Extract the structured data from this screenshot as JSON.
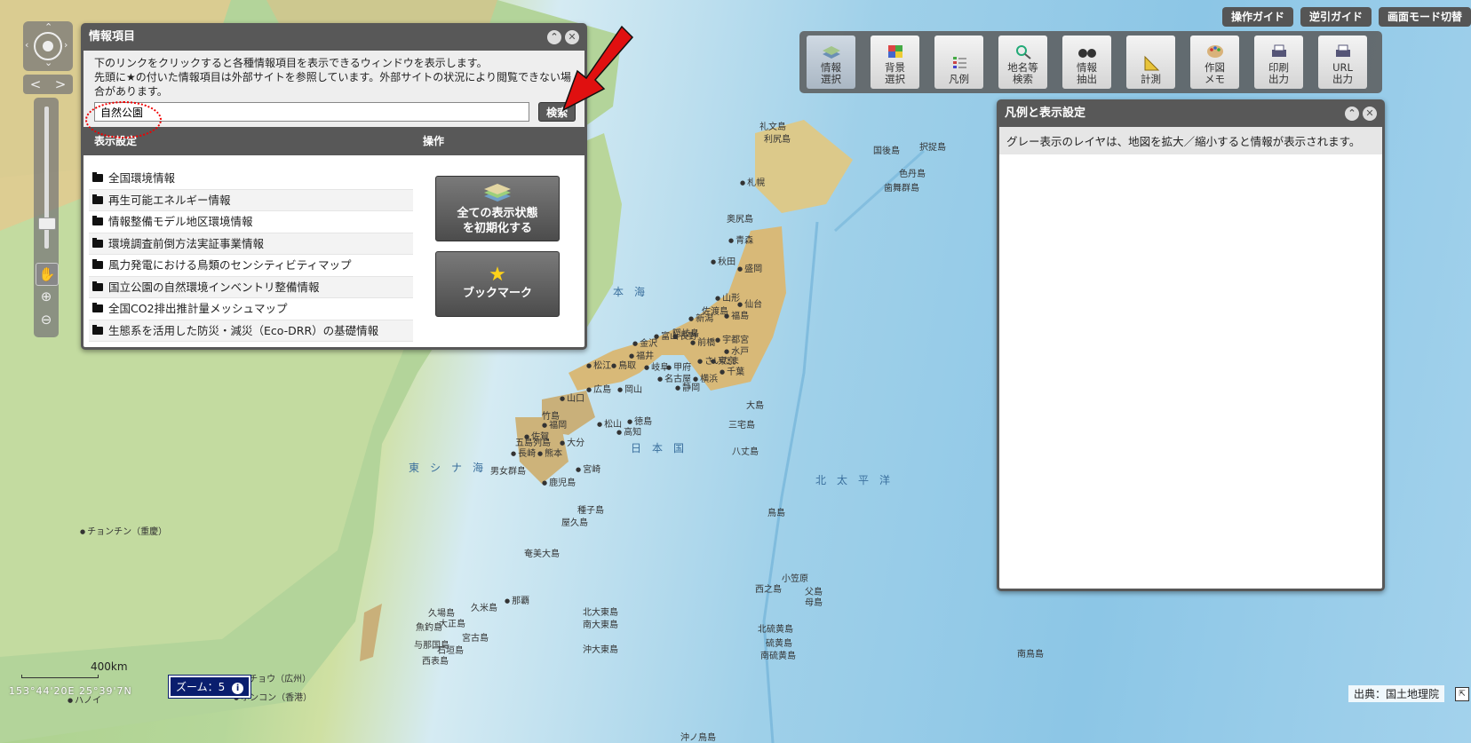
{
  "map": {
    "sea_labels": [
      "本海",
      "東シナ海",
      "日本国",
      "北太平洋"
    ],
    "city_labels": [
      "札幌",
      "青森",
      "秋田",
      "盛岡",
      "山形",
      "仙台",
      "新潟",
      "福島",
      "金沢",
      "富山",
      "長野",
      "前橋",
      "宇都宮",
      "水戸",
      "さいたま",
      "東京",
      "千葉",
      "横浜",
      "甲府",
      "静岡",
      "岐阜",
      "名古屋",
      "福井",
      "松江",
      "鳥取",
      "広島",
      "岡山",
      "山口",
      "松山",
      "高知",
      "徳島",
      "福岡",
      "佐賀",
      "長崎",
      "熊本",
      "大分",
      "宮崎",
      "鹿児島",
      "那覇",
      "チョンチン（重慶）",
      "コワンチョウ（広州）",
      "ホンコン（香港）",
      "ハノイ"
    ],
    "island_labels": [
      "礼文島",
      "利尻島",
      "奥尻島",
      "佐渡島",
      "隠岐島",
      "竹島",
      "屋久島",
      "種子島",
      "奄美大島",
      "大島",
      "八丈島",
      "三宅島",
      "鳥島",
      "小笠原",
      "父島",
      "母島",
      "南鳥島",
      "北大東島",
      "南大東島",
      "沖大東島",
      "与那国島",
      "石垣島",
      "宮古島",
      "久米島",
      "西表島",
      "魚釣島",
      "大正島",
      "久場島",
      "択捉島",
      "国後島",
      "色丹島",
      "歯舞群島",
      "西之島",
      "北硫黄島",
      "硫黄島",
      "南硫黄島",
      "沖ノ鳥島",
      "男女群島",
      "五島列島"
    ]
  },
  "info_panel": {
    "title": "情報項目",
    "description_1": "下のリンクをクリックすると各種情報項目を表示できるウィンドウを表示します。",
    "description_2": "先頭に★の付いた情報項目は外部サイトを参照しています。外部サイトの状況により閲覧できない場合があります。",
    "search_value": "自然公園",
    "search_button": "検索",
    "col_display": "表示設定",
    "col_operation": "操作",
    "items": [
      "全国環境情報",
      "再生可能エネルギー情報",
      "情報整備モデル地区環境情報",
      "環境調査前倒方法実証事業情報",
      "風力発電における鳥類のセンシティビティマップ",
      "国立公園の自然環境インベントリ整備情報",
      "全国CO2排出推計量メッシュマップ",
      "生態系を活用した防災・減災（Eco-DRR）の基礎情報"
    ],
    "reset_label_1": "全ての表示状態",
    "reset_label_2": "を初期化する",
    "bookmark_label": "ブックマーク"
  },
  "top_links": [
    "操作ガイド",
    "逆引ガイド",
    "画面モード切替"
  ],
  "toolbar": [
    {
      "line1": "情報",
      "line2": "選択",
      "icon": "layers-icon"
    },
    {
      "line1": "背景",
      "line2": "選択",
      "icon": "background-icon"
    },
    {
      "line1": "凡例",
      "line2": "",
      "icon": "legend-icon"
    },
    {
      "line1": "地名等",
      "line2": "検索",
      "icon": "place-search-icon"
    },
    {
      "line1": "情報",
      "line2": "抽出",
      "icon": "binoculars-icon"
    },
    {
      "line1": "計測",
      "line2": "",
      "icon": "ruler-icon"
    },
    {
      "line1": "作図",
      "line2": "メモ",
      "icon": "palette-icon"
    },
    {
      "line1": "印刷",
      "line2": "出力",
      "icon": "printer-icon"
    },
    {
      "line1": "URL",
      "line2": "出力",
      "icon": "url-printer-icon"
    }
  ],
  "legend_panel": {
    "title": "凡例と表示設定",
    "message": "グレー表示のレイヤは、地図を拡大／縮小すると情報が表示されます。"
  },
  "scale_label": "400km",
  "coordinates": "153°44'20E 25°39'7N",
  "zoom_label": "ズーム：5",
  "credit": "出典：国土地理院",
  "colors": {
    "panel": "#585858",
    "zoom_badge": "#0a1e6e",
    "arrow": "#e01010"
  }
}
